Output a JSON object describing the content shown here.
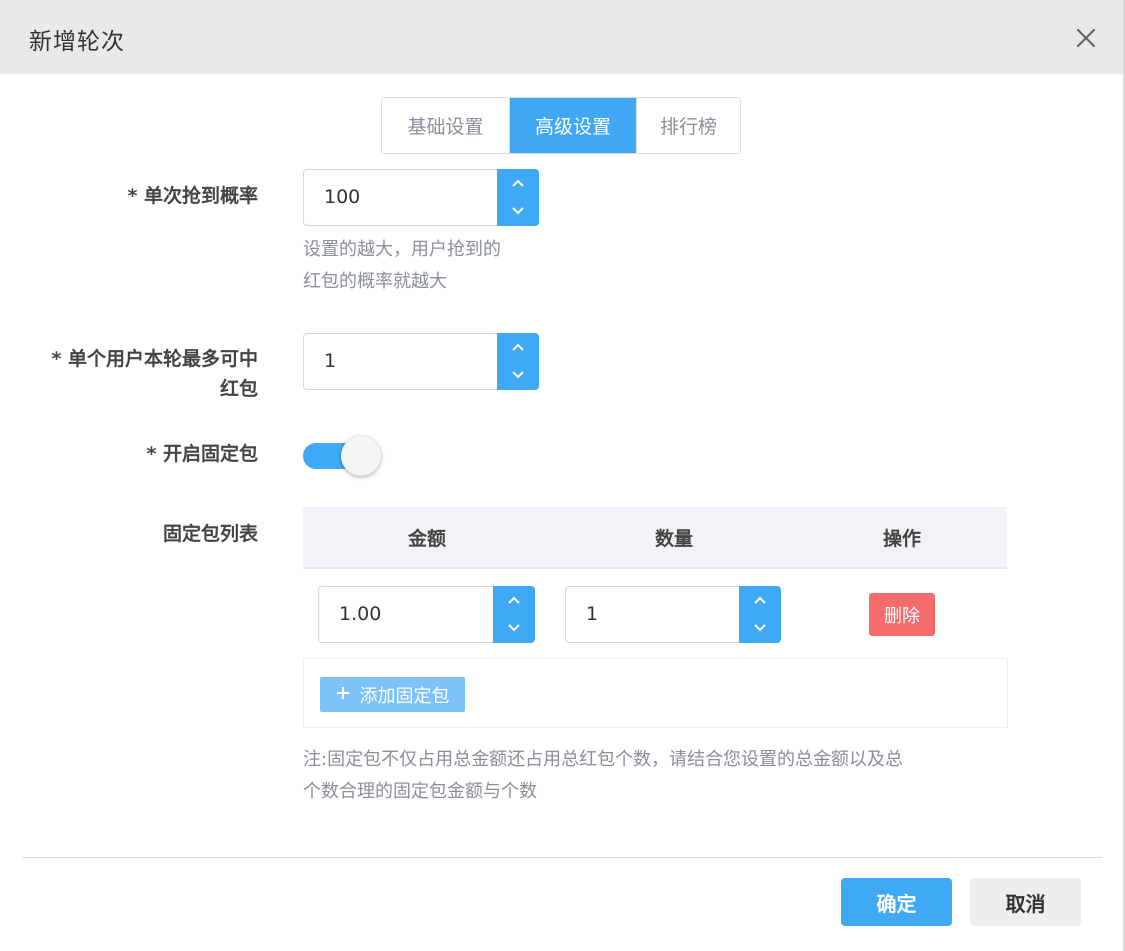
{
  "dialog": {
    "title": "新增轮次",
    "close_icon": "close-icon"
  },
  "tabs": [
    {
      "label": "基础设置",
      "active": false
    },
    {
      "label": "高级设置",
      "active": true
    },
    {
      "label": "排行榜",
      "active": false
    }
  ],
  "form": {
    "probability": {
      "label": "* 单次抢到概率",
      "value": "100",
      "hint_line1": "设置的越大，用户抢到的",
      "hint_line2": "红包的概率就越大"
    },
    "max_per_user": {
      "label_line1": "* 单个用户本轮最多可中",
      "label_line2": "红包",
      "value": "1"
    },
    "fixed_enabled": {
      "label": "* 开启固定包",
      "on": true
    },
    "fixed_list": {
      "label": "固定包列表",
      "columns": [
        "金额",
        "数量",
        "操作"
      ],
      "rows": [
        {
          "amount": "1.00",
          "count": "1",
          "action": "删除"
        }
      ],
      "add_label": "添加固定包"
    },
    "note_line1": "注:固定包不仅占用总金额还占用总红包个数，请结合您设置的总金额以及总",
    "note_line2": "个数合理的固定包金额与个数"
  },
  "footer": {
    "confirm": "确定",
    "cancel": "取消"
  },
  "colors": {
    "primary": "#40a9f5",
    "danger": "#f46c6c",
    "header_bg": "#e9e9e9"
  }
}
